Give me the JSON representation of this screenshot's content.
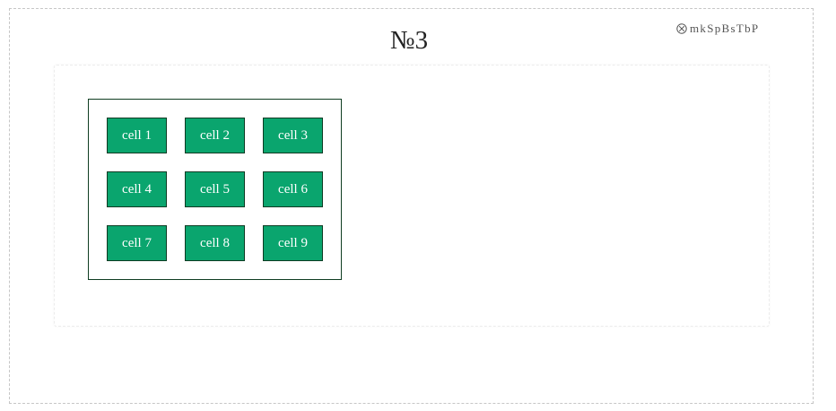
{
  "page": {
    "title": "№3"
  },
  "brand": {
    "icon": "circled-x-icon",
    "label": "mkSpBsTbP"
  },
  "grid": {
    "cells": [
      {
        "label": "cell 1"
      },
      {
        "label": "cell 2"
      },
      {
        "label": "cell 3"
      },
      {
        "label": "cell 4"
      },
      {
        "label": "cell 5"
      },
      {
        "label": "cell 6"
      },
      {
        "label": "cell 7"
      },
      {
        "label": "cell 8"
      },
      {
        "label": "cell 9"
      }
    ]
  },
  "colors": {
    "cell_fill": "#0aa56e",
    "cell_border": "#0d3b23",
    "cell_text": "#ffffff",
    "grid_border": "#0f3d22"
  }
}
